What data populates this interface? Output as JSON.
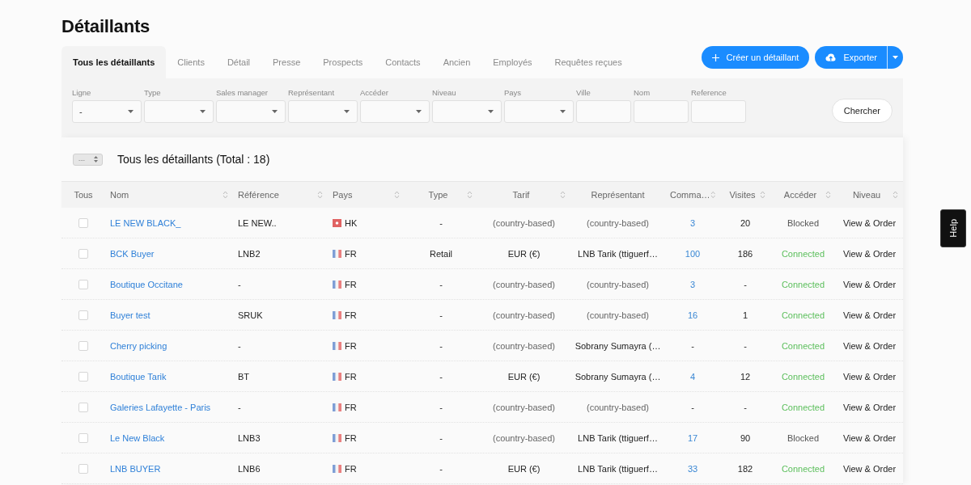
{
  "page": {
    "title": "Détaillants"
  },
  "tabs": [
    {
      "label": "Tous les détaillants",
      "selected": true
    },
    {
      "label": "Clients",
      "selected": false
    },
    {
      "label": "Détail",
      "selected": false
    },
    {
      "label": "Presse",
      "selected": false
    },
    {
      "label": "Prospects",
      "selected": false
    },
    {
      "label": "Contacts",
      "selected": false
    },
    {
      "label": "Ancien",
      "selected": false
    },
    {
      "label": "Employés",
      "selected": false
    },
    {
      "label": "Requêtes reçues",
      "selected": false
    }
  ],
  "actions": {
    "create_button": "Créer un détaillant",
    "export_button": "Exporter"
  },
  "filters": {
    "fields": [
      {
        "label": "Ligne",
        "kind": "select",
        "value": "-"
      },
      {
        "label": "Type",
        "kind": "select"
      },
      {
        "label": "Sales manager",
        "kind": "select"
      },
      {
        "label": "Représentant",
        "kind": "select"
      },
      {
        "label": "Accéder",
        "kind": "select"
      },
      {
        "label": "Niveau",
        "kind": "select"
      },
      {
        "label": "Pays",
        "kind": "select"
      },
      {
        "label": "Ville",
        "kind": "text"
      },
      {
        "label": "Nom",
        "kind": "text"
      },
      {
        "label": "Reference",
        "kind": "text"
      }
    ],
    "search_button": "Chercher"
  },
  "table": {
    "page_size": "---",
    "heading": "Tous les détaillants (Total : 18)",
    "columns": [
      {
        "label": "Tous",
        "sortable": false
      },
      {
        "label": "Nom",
        "sortable": true
      },
      {
        "label": "Référence",
        "sortable": true
      },
      {
        "label": "Pays",
        "sortable": true
      },
      {
        "label": "Type",
        "sortable": true
      },
      {
        "label": "Tarif",
        "sortable": true
      },
      {
        "label": "Représentant",
        "sortable": false
      },
      {
        "label": "Comma…",
        "sortable": true
      },
      {
        "label": "Visites",
        "sortable": true
      },
      {
        "label": "Accéder",
        "sortable": true
      },
      {
        "label": "Niveau",
        "sortable": true
      }
    ],
    "rows": [
      {
        "selected": false,
        "name": "LE NEW BLACK_",
        "reference": "LE NEW..",
        "flag": {
          "kind": "hk"
        },
        "country": "HK",
        "type": "-",
        "tarif": "(country-based)",
        "tarif_inherited": true,
        "representative": "(country-based)",
        "representative_inherited": true,
        "orders": "3",
        "orders_link": true,
        "visits": "20",
        "access": "Blocked",
        "access_connected": false,
        "niveau": "View & Order"
      },
      {
        "selected": false,
        "name": "BCK Buyer",
        "reference": "LNB2",
        "flag": {
          "kind": "fr"
        },
        "country": "FR",
        "type": "Retail",
        "tarif": "EUR (€)",
        "tarif_inherited": false,
        "representative": "LNB Tarik (ttiguerf…",
        "representative_inherited": false,
        "orders": "100",
        "orders_link": true,
        "visits": "186",
        "access": "Connected",
        "access_connected": true,
        "niveau": "View & Order"
      },
      {
        "selected": false,
        "name": "Boutique Occitane",
        "reference": "-",
        "flag": {
          "kind": "fr"
        },
        "country": "FR",
        "type": "-",
        "tarif": "(country-based)",
        "tarif_inherited": true,
        "representative": "(country-based)",
        "representative_inherited": true,
        "orders": "3",
        "orders_link": true,
        "visits": "-",
        "access": "Connected",
        "access_connected": true,
        "niveau": "View & Order"
      },
      {
        "selected": false,
        "name": "Buyer test",
        "reference": "SRUK",
        "flag": {
          "kind": "fr"
        },
        "country": "FR",
        "type": "-",
        "tarif": "(country-based)",
        "tarif_inherited": true,
        "representative": "(country-based)",
        "representative_inherited": true,
        "orders": "16",
        "orders_link": true,
        "visits": "1",
        "access": "Connected",
        "access_connected": true,
        "niveau": "View & Order"
      },
      {
        "selected": false,
        "name": "Cherry picking",
        "reference": "-",
        "flag": {
          "kind": "fr"
        },
        "country": "FR",
        "type": "-",
        "tarif": "(country-based)",
        "tarif_inherited": true,
        "representative": "Sobrany Sumayra (…",
        "representative_inherited": false,
        "orders": "-",
        "orders_link": false,
        "visits": "-",
        "access": "Connected",
        "access_connected": true,
        "niveau": "View & Order"
      },
      {
        "selected": false,
        "name": "Boutique Tarik",
        "reference": "BT",
        "flag": {
          "kind": "fr"
        },
        "country": "FR",
        "type": "-",
        "tarif": "EUR (€)",
        "tarif_inherited": false,
        "representative": "Sobrany Sumayra (…",
        "representative_inherited": false,
        "orders": "4",
        "orders_link": true,
        "visits": "12",
        "access": "Connected",
        "access_connected": true,
        "niveau": "View & Order"
      },
      {
        "selected": false,
        "name": "Galeries Lafayette - Paris",
        "reference": "-",
        "flag": {
          "kind": "fr"
        },
        "country": "FR",
        "type": "-",
        "tarif": "(country-based)",
        "tarif_inherited": true,
        "representative": "(country-based)",
        "representative_inherited": true,
        "orders": "-",
        "orders_link": false,
        "visits": "-",
        "access": "Connected",
        "access_connected": true,
        "niveau": "View & Order"
      },
      {
        "selected": false,
        "name": "Le New Black",
        "reference": "LNB3",
        "flag": {
          "kind": "fr"
        },
        "country": "FR",
        "type": "-",
        "tarif": "(country-based)",
        "tarif_inherited": true,
        "representative": "LNB Tarik (ttiguerf…",
        "representative_inherited": false,
        "orders": "17",
        "orders_link": true,
        "visits": "90",
        "access": "Blocked",
        "access_connected": false,
        "niveau": "View & Order"
      },
      {
        "selected": false,
        "name": "LNB BUYER",
        "reference": "LNB6",
        "flag": {
          "kind": "fr"
        },
        "country": "FR",
        "type": "-",
        "tarif": "EUR (€)",
        "tarif_inherited": false,
        "representative": "LNB Tarik (ttiguerf…",
        "representative_inherited": false,
        "orders": "33",
        "orders_link": true,
        "visits": "182",
        "access": "Connected",
        "access_connected": true,
        "niveau": "View & Order"
      }
    ]
  },
  "help": {
    "label": "Help"
  }
}
